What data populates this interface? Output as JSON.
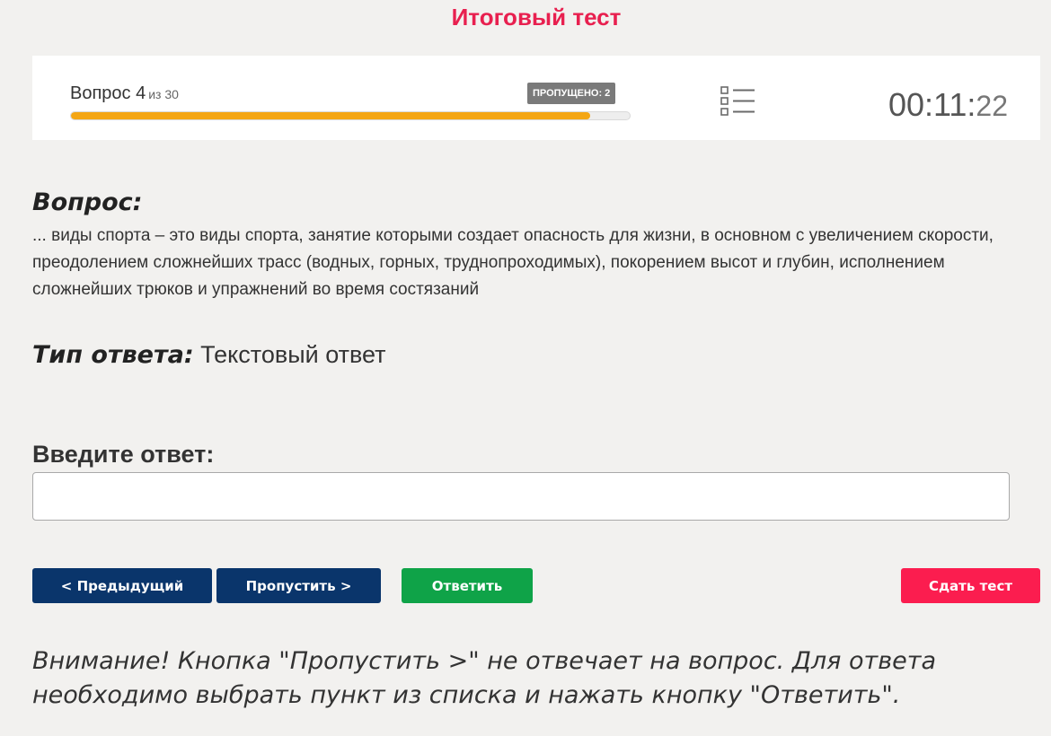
{
  "page": {
    "title": "Итоговый тест"
  },
  "status": {
    "question_label": "Вопрос 4",
    "of_label": "из 30",
    "skipped_badge": "ПРОПУЩЕНО: 2",
    "progress_fraction": 0.93,
    "progress_color": "#f4a614",
    "list_icon": "list-icon",
    "timer_main": "00:11:",
    "timer_seconds": "22"
  },
  "question": {
    "heading": "Вопрос:",
    "text": "... виды спорта – это виды спорта, занятие которыми создает опасность для жизни, в основном с увеличением скорости, преодолением сложнейших трасс (водных, горных, труднопроходимых), покорением высот и глубин, исполнением сложнейших трюков и упражнений во время состязаний"
  },
  "answer_type": {
    "label": "Тип ответа:",
    "value": "Текстовый ответ"
  },
  "answer_input": {
    "label": "Введите ответ:",
    "value": "",
    "placeholder": ""
  },
  "buttons": {
    "prev": "< Предыдущий",
    "skip": "Пропустить >",
    "answer": "Ответить",
    "submit": "Сдать тест"
  },
  "colors": {
    "accent_title": "#e8204f",
    "nav_button": "#0a356b",
    "answer_button": "#0fa348",
    "submit_button": "#fb1d4f"
  },
  "notice": {
    "text": "Внимание! Кнопка \"Пропустить >\" не отвечает на вопрос. Для ответа необходимо выбрать пункт из списка и нажать кнопку \"Ответить\"."
  }
}
